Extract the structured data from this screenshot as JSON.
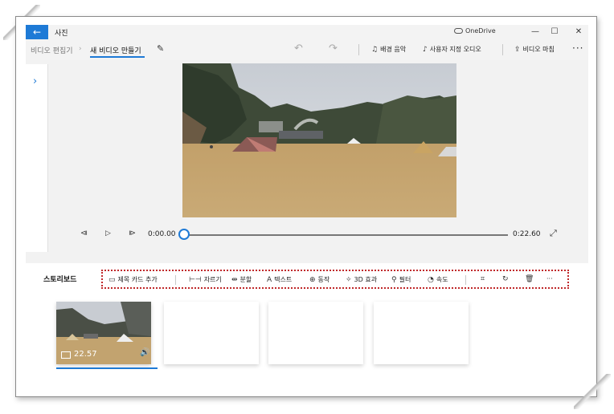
{
  "window": {
    "app_title": "사진",
    "back_icon": "←",
    "onedrive_label": "OneDrive",
    "minimize": "—",
    "maximize": "☐",
    "close": "✕"
  },
  "breadcrumb": {
    "item1": "비디오 편집기",
    "separator": "›",
    "item2": "새 비디오 만들기"
  },
  "commands": {
    "background_music": "배경 음악",
    "custom_audio": "사용자 지정 오디오",
    "finish_video": "비디오 마침",
    "more": "···"
  },
  "player": {
    "current_time": "0:00.00",
    "total_time": "0:22.60",
    "progress_fraction": 0
  },
  "storyboard": {
    "title": "스토리보드",
    "tools": {
      "add_title_card": "제목 카드 추가",
      "trim": "자르기",
      "split": "분할",
      "text": "텍스트",
      "motion": "동작",
      "effects_3d": "3D 효과",
      "filters": "필터",
      "speed": "속도",
      "more": "···"
    },
    "clips": [
      {
        "duration": "22.57"
      }
    ]
  },
  "colors": {
    "accent": "#1e7ad6",
    "highlight_border": "#c0282a"
  }
}
